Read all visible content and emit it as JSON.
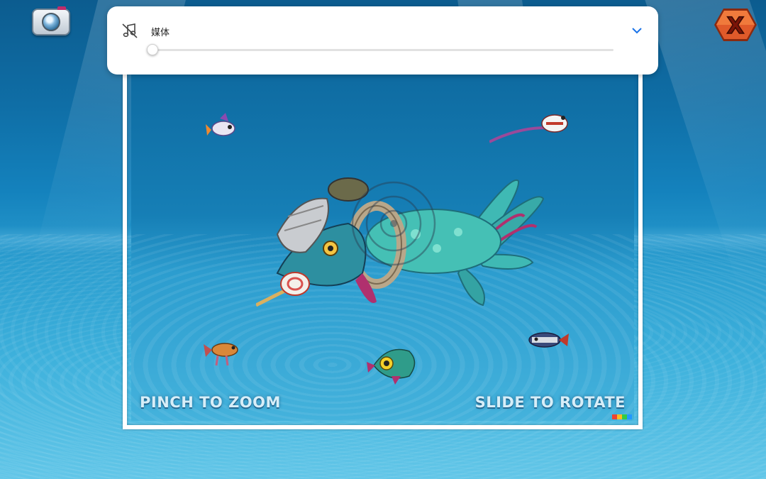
{
  "media_panel": {
    "label": "媒体",
    "icon": "music-off-icon",
    "expand_icon": "chevron-down-icon",
    "slider_level": 0
  },
  "viewer": {
    "hint_left": "PINCH TO ZOOM",
    "hint_right": "SLIDE TO ROTATE"
  },
  "buttons": {
    "camera_icon": "camera-icon",
    "close_label": "X",
    "close_color": "#e05a2a"
  },
  "colors": {
    "water_deep": "#0c5c8f",
    "water_light": "#62c6e8",
    "creature_teal": "#3fb9b4",
    "creature_pink": "#b0306e"
  }
}
